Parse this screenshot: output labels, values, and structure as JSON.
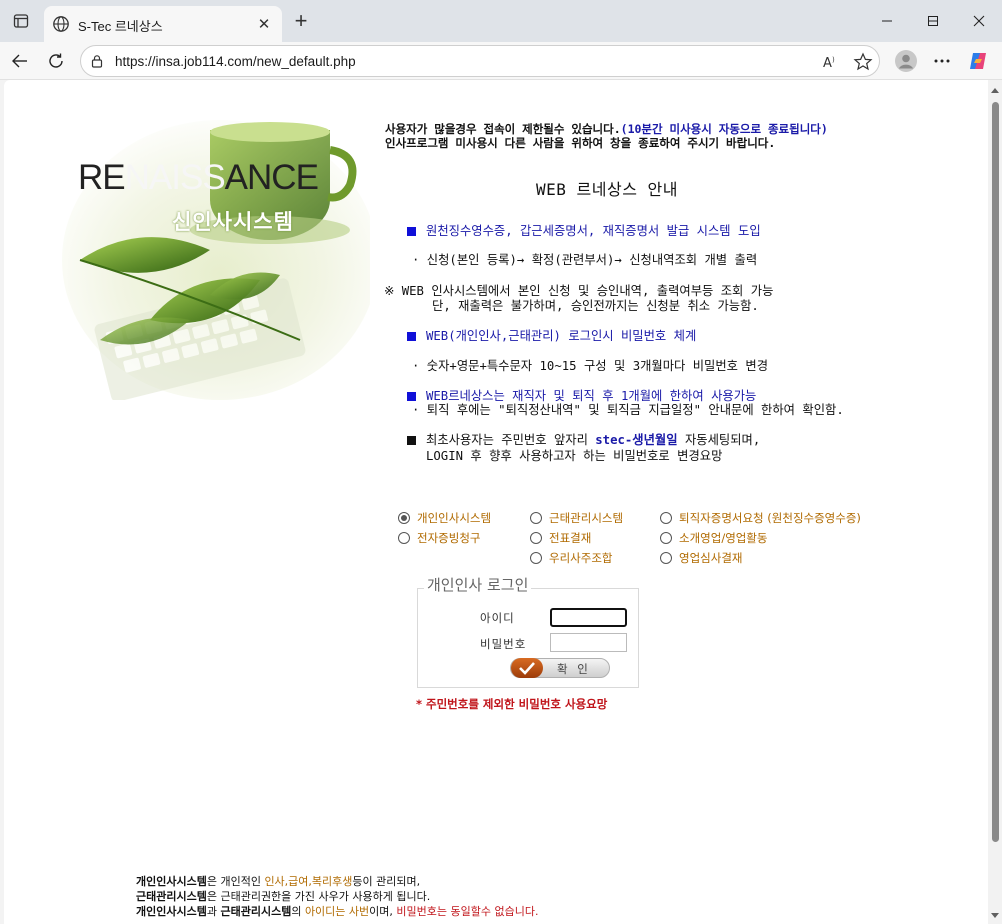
{
  "browser": {
    "tab_title": "S-Tec 르네상스",
    "url": "https://insa.job114.com/new_default.php"
  },
  "hero": {
    "title_a": "RE",
    "title_b": "NAISS",
    "title_c": "ANCE",
    "subtitle": "신인사시스템"
  },
  "notice": {
    "line1": "사용자가 많을경우 접속이 제한될수 있습니다.",
    "line1_blue": "(10분간 미사용시 자동으로 종료됩니다)",
    "line2": "인사프로그램 미사용시 다른 사람을 위하여 창을 종료하여 주시기 바랍니다."
  },
  "guide": {
    "title": "WEB 르네상스 안내",
    "item1": "원천징수영수증, 갑근세증명서, 재직증명서 발급 시스템 도입",
    "item1_sub": "· 신청(본인 등록)→ 확정(관련부서)→ 신청내역조회 개별 출력",
    "item1_note1": "※ WEB 인사시스템에서 본인 신청 및 승인내역, 출력여부등 조회 가능",
    "item1_note2": "단, 재출력은 불가하며, 승인전까지는 신청분 취소 가능함.",
    "item2": "WEB(개인인사,근태관리) 로그인시 비밀번호 체계",
    "item2_sub": "· 숫자+영문+특수문자 10~15 구성 및 3개월마다 비밀번호 변경",
    "item3": "WEB르네상스는 재직자 및 퇴직 후 1개월에 한하여 사용가능",
    "item3_sub": "· 퇴직 후에는 \"퇴직정산내역\" 및 퇴직금 지급일정\" 안내문에 한하여 확인함.",
    "item4_a": "최초사용자는 주민번호 앞자리 ",
    "item4_b": "stec-생년월일",
    "item4_c": " 자동세팅되며,",
    "item4_line2": "LOGIN 후 향후 사용하고자 하는 비밀번호로 변경요망"
  },
  "systems": {
    "personnel": "개인인사시스템",
    "attendance": "근태관리시스템",
    "retirement_cert": "퇴직자증명서요청 (원천징수증영수증)",
    "expense": "전자증빙청구",
    "voucher": "전표결재",
    "sales": "소개영업/영업활동",
    "union": "우리사주조합",
    "sales_review": "영업심사결재"
  },
  "login": {
    "legend": "개인인사 로그인",
    "id_label": "아이디",
    "pw_label": "비밀번호",
    "confirm": "확 인",
    "warning": "* 주민번호를 제외한 비밀번호 사용요망"
  },
  "bottom": {
    "l1_a": "개인인사시스템",
    "l1_b": "은 개인적인 ",
    "l1_c": "인사,급여,복리후생",
    "l1_d": "등이 관리되며,",
    "l2_a": "근태관리시스템",
    "l2_b": "은 근태관리권한을 가진 사우가 사용하게 됩니다.",
    "l3_a": "개인인사시스템",
    "l3_b": "과 ",
    "l3_c": "근태관리시스템",
    "l3_d": "의 ",
    "l3_e": "아이디는 사번",
    "l3_f": "이며, ",
    "l3_g": "비밀번호는 동일할수 없습니다."
  }
}
